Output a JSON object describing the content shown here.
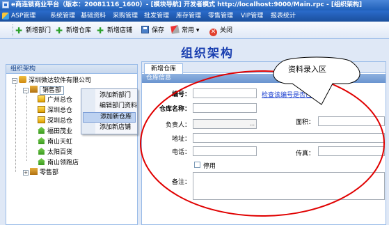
{
  "window": {
    "title": "e商连锁商业平台（版本：20081116_1600）- [模块导航] 开发者模式 http://localhost:9000/Main.rpc - [组织架构]"
  },
  "menu": [
    "ASP管理",
    "系统管理",
    "基础资料",
    "采购管理",
    "批发管理",
    "库存管理",
    "零售管理",
    "VIP管理",
    "报表统计"
  ],
  "toolbar": {
    "add_dept": "新增部门",
    "add_warehouse": "新增仓库",
    "add_store": "新增店铺",
    "save": "保存",
    "common": "常用",
    "close": "关闭"
  },
  "page_title": "组织架构",
  "tree": {
    "header": "组织架构",
    "root": "深圳微达软件有限公司",
    "sales_dept": "销售部",
    "children": [
      "广州总仓",
      "深圳总仓",
      "深圳总仓",
      "福田茂业",
      "南山天虹",
      "太阳百货",
      "南山领跑店"
    ],
    "retail_dept": "零售部"
  },
  "context_menu": [
    "添加新部门",
    "编辑部门资料",
    "添加新仓库",
    "添加新店铺"
  ],
  "form": {
    "tab": "新增仓库",
    "section": "仓库信息",
    "code_label": "编号：",
    "code_link": "检查该编号是否已被使",
    "name_label": "仓库名称：",
    "manager_label": "负责人：",
    "manager_trigger": "...",
    "area_label": "面积：",
    "address_label": "地址：",
    "phone_label": "电话：",
    "fax_label": "传真：",
    "disabled_label": "停用",
    "remark_label": "备注："
  },
  "annotation": {
    "callout": "资料录入区"
  },
  "colors": {
    "accent": "#1a3fb0",
    "annotation": "#e00000",
    "menubar": "#1f5fb8"
  }
}
